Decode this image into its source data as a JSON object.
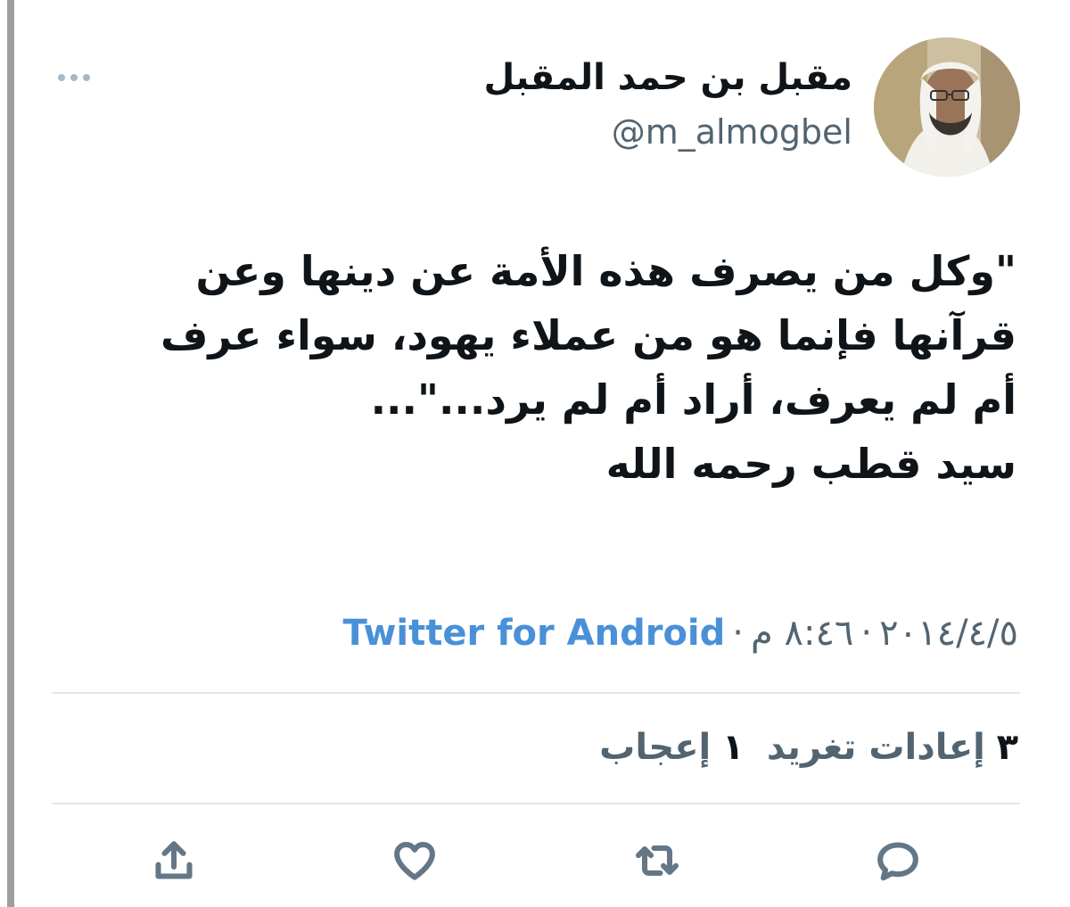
{
  "tweet": {
    "author": {
      "display_name": "مقبل بن حمد المقبل",
      "handle": "@m_almogbel",
      "avatar_icon": "user-avatar"
    },
    "more_icon": "more-horizontal-icon",
    "text_lines": [
      "\"وكل من يصرف هذه الأمة عن دينها وعن",
      "قرآنها فإنما هو من عملاء يهود، سواء عرف",
      "أم لم يعرف، أراد أم لم يرد...\"...",
      "سيد قطب رحمه الله"
    ],
    "meta": {
      "date": "٢٠١٤/٤/٥",
      "separator": "·",
      "time": "٨:٤٦ م",
      "source": "Twitter for Android"
    },
    "stats": {
      "retweets_count": "٣",
      "retweets_label": "إعادات تغريد",
      "likes_count": "١",
      "likes_label": "إعجاب"
    },
    "actions": {
      "reply_icon": "reply-icon",
      "retweet_icon": "retweet-icon",
      "like_icon": "heart-icon",
      "share_icon": "share-icon"
    },
    "colors": {
      "text": "#0f1419",
      "secondary": "#536471",
      "link": "#4a90d9",
      "divider": "#e1e8ed",
      "icon": "#657786"
    }
  }
}
